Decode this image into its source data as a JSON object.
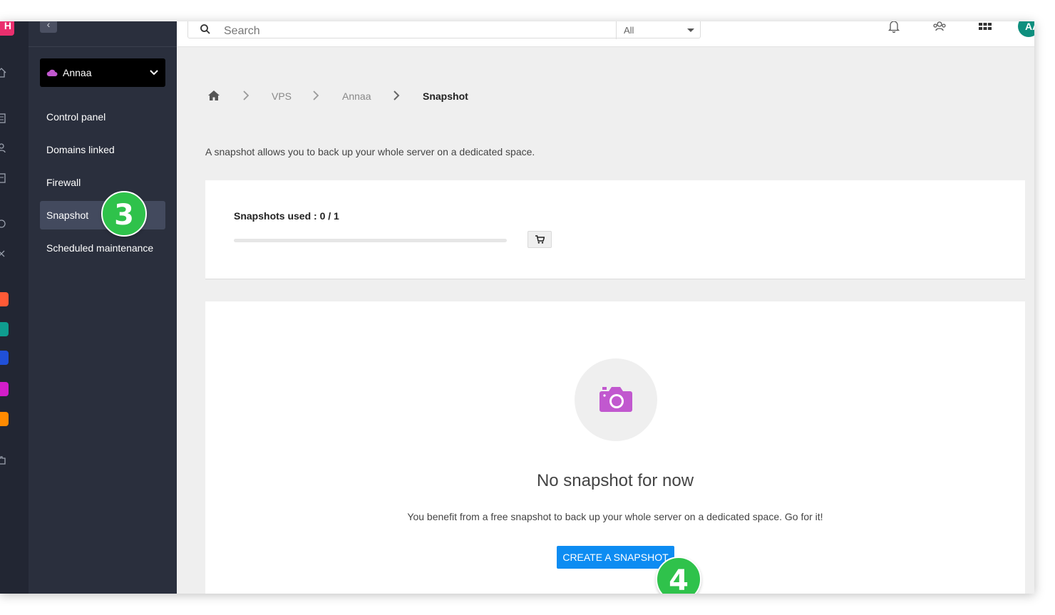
{
  "rail": {
    "brand_label": "H",
    "app_colors": [
      "#ff5a36",
      "#0f9d8f",
      "#2050d8",
      "#d21dc8",
      "#ff8a00"
    ]
  },
  "sidebar": {
    "product_name": "Annaa",
    "product_icon": "cloud-icon",
    "items": [
      {
        "label": "Control panel",
        "active": false
      },
      {
        "label": "Domains linked",
        "active": false
      },
      {
        "label": "Firewall",
        "active": false
      },
      {
        "label": "Snapshot",
        "active": true
      },
      {
        "label": "Scheduled maintenance",
        "active": false
      }
    ]
  },
  "header": {
    "search_placeholder": "Search",
    "search_scope": "All",
    "avatar_initials": "AA"
  },
  "breadcrumb": {
    "home_icon": "home-icon",
    "items": [
      "VPS",
      "Annaa",
      "Snapshot"
    ]
  },
  "main": {
    "intro": "A snapshot allows you to back up your whole server on a dedicated space.",
    "usage_label": "Snapshots used : 0 / 1",
    "usage_fraction": 0.0,
    "empty_title": "No snapshot for now",
    "empty_description": "You benefit from a free snapshot to back up your whole server on a dedicated space. Go for it!",
    "create_button": "CREATE A SNAPSHOT"
  },
  "steps": {
    "step_sidebar": "3",
    "step_button": "4"
  },
  "colors": {
    "accent_blue": "#0d8cf2",
    "camera_purple": "#c158cf",
    "step_green": "#2fc24b",
    "sidebar_bg": "#2a2f3d"
  }
}
